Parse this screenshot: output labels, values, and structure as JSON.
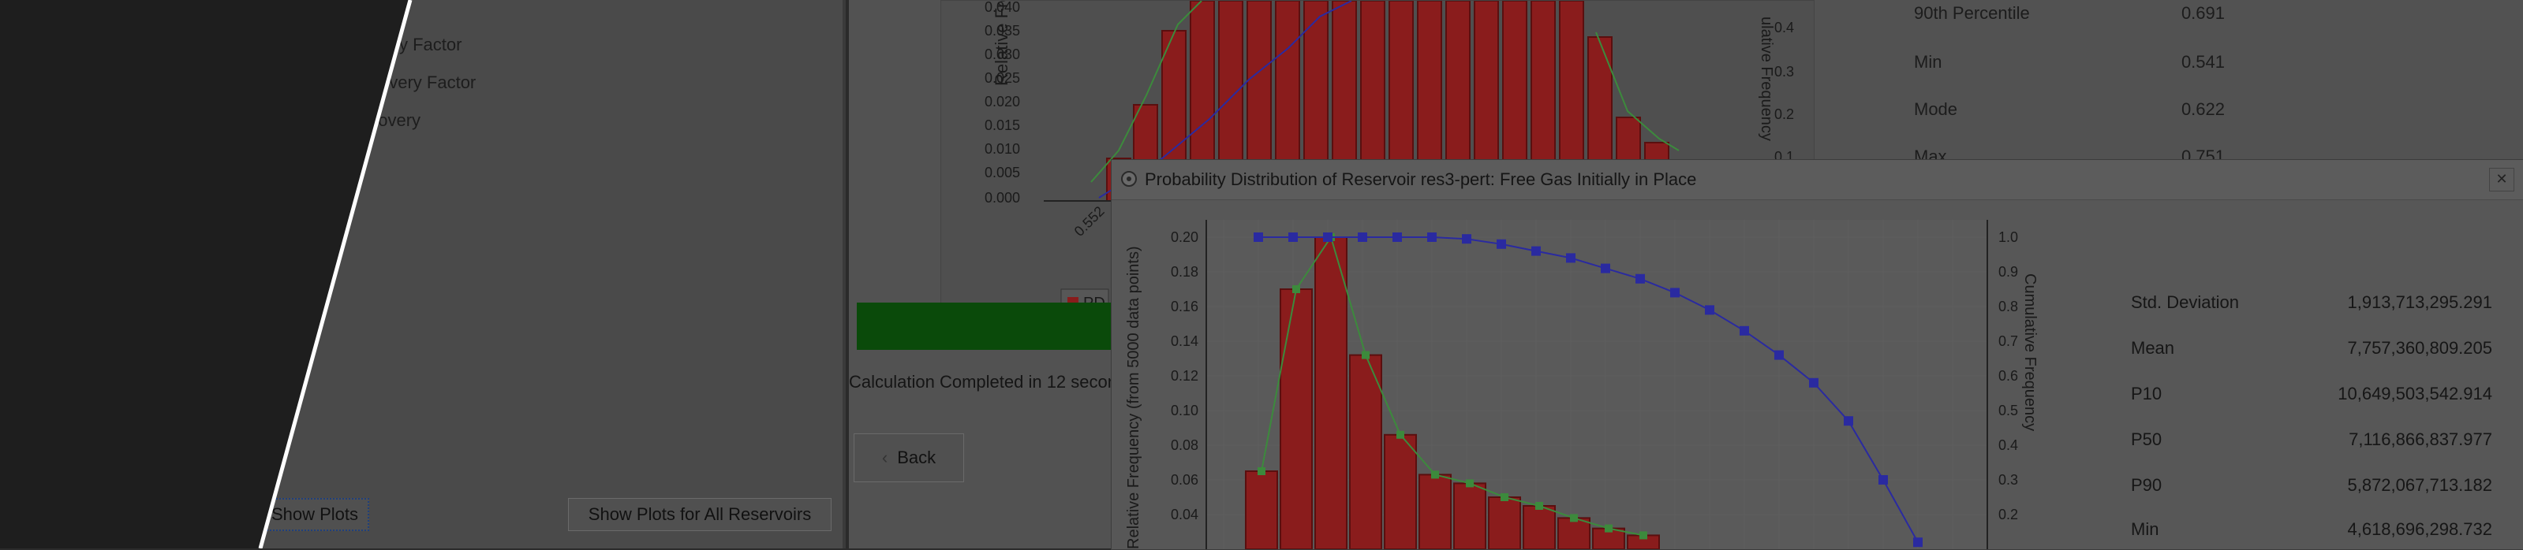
{
  "left_panel": {
    "tree_items": [
      "y Factor",
      "covery Factor",
      "ecovery"
    ],
    "show_plots_label": "Show Plots",
    "show_all_label": "Show Plots for All Reservoirs"
  },
  "background_window": {
    "chart": {
      "ylabel": "Relative Frequenc",
      "y2label": "ulative Frequency",
      "y_ticks": [
        "0.040",
        "0.035",
        "0.030",
        "0.025",
        "0.020",
        "0.015",
        "0.010",
        "0.005",
        "0.000"
      ],
      "y2_ticks": [
        "0.4",
        "0.3",
        "0.2",
        "0.1"
      ],
      "x_tick": "0.552",
      "legend_label": "PD"
    },
    "stats": [
      {
        "label": "90th Percentile",
        "value": "0.691"
      },
      {
        "label": "Min",
        "value": "0.541"
      },
      {
        "label": "Mode",
        "value": "0.622"
      },
      {
        "label": "Max",
        "value": "0.751"
      }
    ],
    "calc_text": "Calculation Completed in 12 secon",
    "back_label": "Back"
  },
  "dialog": {
    "title": "Probability Distribution of Reservoir res3-pert: Free Gas Initially in Place",
    "close_label": "✕",
    "stats": [
      {
        "label": "Std. Deviation",
        "value": "1,913,713,295.291"
      },
      {
        "label": "Mean",
        "value": "7,757,360,809.205"
      },
      {
        "label": "P10",
        "value": "10,649,503,542.914"
      },
      {
        "label": "P50",
        "value": "7,116,866,837.977"
      },
      {
        "label": "P90",
        "value": "5,872,067,713.182"
      },
      {
        "label": "Min",
        "value": "4,618,696,298.732"
      }
    ]
  },
  "chart_data": {
    "type": "bar",
    "ylabel": "Relative Frequency (from 5000 data points)",
    "y2label": "Cumulative Frequency",
    "y_ticks": [
      "0.20",
      "0.18",
      "0.16",
      "0.14",
      "0.12",
      "0.10",
      "0.08",
      "0.06",
      "0.04"
    ],
    "y2_ticks": [
      "1.0",
      "0.9",
      "0.8",
      "0.7",
      "0.6",
      "0.5",
      "0.4",
      "0.3",
      "0.2"
    ],
    "ylim": [
      0.02,
      0.21
    ],
    "y2lim": [
      0.1,
      1.05
    ],
    "bars": [
      0.065,
      0.17,
      0.2,
      0.132,
      0.086,
      0.063,
      0.058,
      0.05,
      0.045,
      0.038,
      0.032,
      0.028
    ],
    "pdf_line": [
      0.065,
      0.17,
      0.2,
      0.132,
      0.086,
      0.063,
      0.058,
      0.05,
      0.045,
      0.038,
      0.032,
      0.028
    ],
    "cumulative": [
      1.0,
      1.0,
      1.0,
      1.0,
      1.0,
      1.0,
      0.995,
      0.98,
      0.96,
      0.94,
      0.91,
      0.88,
      0.84,
      0.79,
      0.73,
      0.66,
      0.58,
      0.47,
      0.3,
      0.12
    ]
  },
  "colors": {
    "bar": "#8a1c1c",
    "pdf_line": "#3c8a3c",
    "cdf_line": "#2a2aa0",
    "grid": "#5e5e5e"
  }
}
